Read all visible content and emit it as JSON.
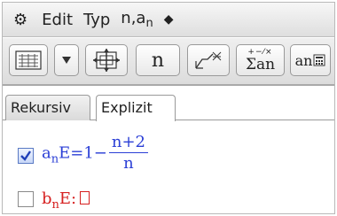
{
  "menu": {
    "edit": "Edit",
    "typ": "Typ",
    "seq_prefix": "n,a",
    "seq_sub": "n"
  },
  "toolbar": {
    "n_button": "n",
    "sum_button_sym": "Σan",
    "sum_button_ops": "+−⁄×",
    "an_button": "an"
  },
  "tabs": [
    {
      "label": "Rekursiv",
      "active": false
    },
    {
      "label": "Explizit",
      "active": true
    }
  ],
  "formulas": [
    {
      "checked": true,
      "name": "a",
      "sub": "n",
      "eq": "E=1−",
      "frac_num": "n+2",
      "frac_den": "n",
      "color": "#2b3fd6"
    },
    {
      "checked": false,
      "name": "b",
      "sub": "n",
      "eq": "E:",
      "color": "#d62020"
    }
  ]
}
